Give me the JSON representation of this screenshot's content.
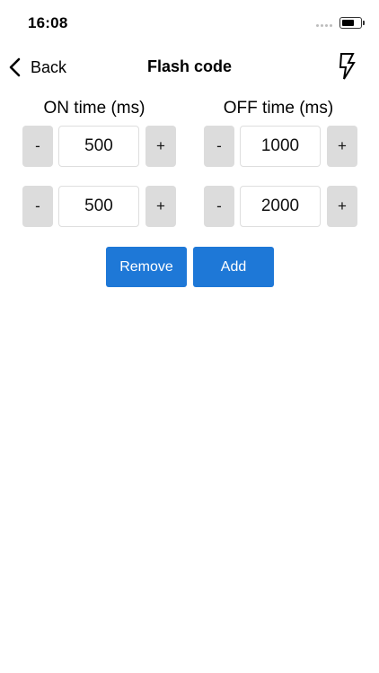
{
  "status_bar": {
    "time": "16:08"
  },
  "nav": {
    "back_label": "Back",
    "title": "Flash code"
  },
  "columns": {
    "on_header": "ON time (ms)",
    "off_header": "OFF time (ms)"
  },
  "stepper": {
    "minus_label": "-",
    "plus_label": "+"
  },
  "rows": [
    {
      "on_value": "500",
      "off_value": "1000"
    },
    {
      "on_value": "500",
      "off_value": "2000"
    }
  ],
  "actions": {
    "remove_label": "Remove",
    "add_label": "Add"
  },
  "colors": {
    "accent": "#1e78d7",
    "stepper_bg": "#dcdcdc"
  }
}
